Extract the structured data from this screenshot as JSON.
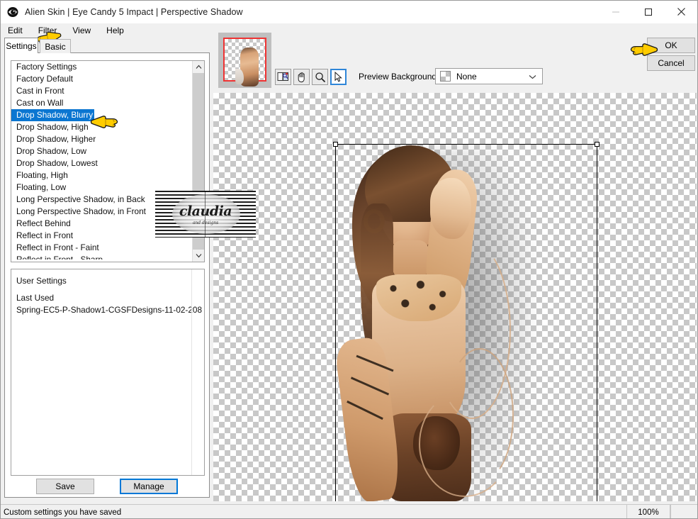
{
  "window": {
    "title": "Alien Skin | Eye Candy 5 Impact | Perspective Shadow",
    "app_icon": "eye-candy-icon",
    "minimize": "—",
    "maximize": "□",
    "close": "×"
  },
  "menu": {
    "items": [
      {
        "label": "Edit"
      },
      {
        "label": "Filter"
      },
      {
        "label": "View"
      },
      {
        "label": "Help"
      }
    ]
  },
  "tabs": [
    {
      "label": "Settings",
      "active": true
    },
    {
      "label": "Basic",
      "active": false
    }
  ],
  "settings_list": {
    "items": [
      {
        "label": "Factory Settings",
        "selected": false,
        "header": true
      },
      {
        "label": "Factory Default",
        "selected": false
      },
      {
        "label": "Cast in Front",
        "selected": false
      },
      {
        "label": "Cast on Wall",
        "selected": false
      },
      {
        "label": "Drop Shadow, Blurry",
        "selected": true
      },
      {
        "label": "Drop Shadow, High",
        "selected": false
      },
      {
        "label": "Drop Shadow, Higher",
        "selected": false
      },
      {
        "label": "Drop Shadow, Low",
        "selected": false
      },
      {
        "label": "Drop Shadow, Lowest",
        "selected": false
      },
      {
        "label": "Floating, High",
        "selected": false
      },
      {
        "label": "Floating, Low",
        "selected": false
      },
      {
        "label": "Long Perspective Shadow, in Back",
        "selected": false
      },
      {
        "label": "Long Perspective Shadow, in Front",
        "selected": false
      },
      {
        "label": "Reflect Behind",
        "selected": false
      },
      {
        "label": "Reflect in Front",
        "selected": false
      },
      {
        "label": "Reflect in Front - Faint",
        "selected": false
      },
      {
        "label": "Reflect in Front - Sharp",
        "selected": false,
        "clipped": true
      }
    ],
    "scroll_up_icon": "chevron-up-icon",
    "scroll_down_icon": "chevron-down-icon"
  },
  "user_settings": {
    "header": "User Settings",
    "items": [
      {
        "label": "Last Used"
      },
      {
        "label": "Spring-EC5-P-Shadow1-CGSFDesigns-11-02-208"
      }
    ]
  },
  "left_buttons": {
    "save": "Save",
    "manage": "Manage"
  },
  "preview_toolbar": {
    "tools": [
      {
        "name": "split-preview-icon",
        "active": false
      },
      {
        "name": "hand-pan-icon",
        "active": false
      },
      {
        "name": "magnifier-zoom-icon",
        "active": false
      },
      {
        "name": "arrow-select-icon",
        "active": true
      }
    ],
    "background_label": "Preview Background:",
    "background_value": "None",
    "background_swatch": "transparent-checker",
    "caret_icon": "chevron-down-icon"
  },
  "dialog_buttons": {
    "ok": "OK",
    "cancel": "Cancel"
  },
  "watermark": {
    "text": "claudia",
    "subtext": "and designs"
  },
  "statusbar": {
    "message": "Custom settings you have saved",
    "zoom": "100%"
  },
  "colors": {
    "selection_blue": "#0b76d1",
    "focus_blue": "#0078d7",
    "thumbnail_border_red": "#ef3333",
    "pointer_yellow": "#ffcc00",
    "window_bg": "#f0f0f0",
    "panel_white": "#ffffff"
  },
  "pointers": [
    {
      "name": "pointer-cursor-filter-menu"
    },
    {
      "name": "pointer-cursor-selected-preset"
    },
    {
      "name": "pointer-cursor-ok-button"
    }
  ]
}
